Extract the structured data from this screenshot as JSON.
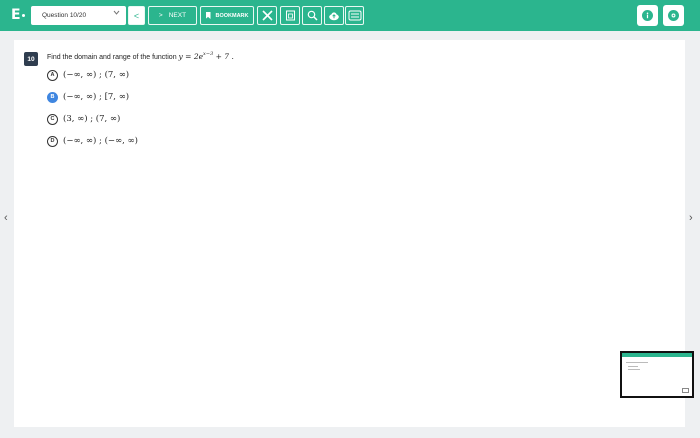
{
  "brand": {
    "logo": "E"
  },
  "toolbar": {
    "question_select": "Question 10/20",
    "prev_label": "<",
    "next_label": "NEXT",
    "next_arrow": ">",
    "bookmark_label": "BOOKMARK",
    "accent_color": "#2bb58e"
  },
  "question": {
    "number": "10",
    "prompt": "Find the domain and range of the function",
    "function_lhs": "y = 2e",
    "function_exponent": "x−3",
    "function_rhs": " + 7 .",
    "choices": [
      {
        "letter": "A",
        "text": "(−∞, ∞) ;  (7, ∞)",
        "selected": false
      },
      {
        "letter": "B",
        "text": "(−∞, ∞) ;  [7, ∞)",
        "selected": true
      },
      {
        "letter": "C",
        "text": "(3, ∞) ;  (7, ∞)",
        "selected": false
      },
      {
        "letter": "D",
        "text": "(−∞, ∞) ;  (−∞, ∞)",
        "selected": false
      }
    ]
  },
  "navigation": {
    "left_arrow": "‹",
    "right_arrow": "›"
  }
}
